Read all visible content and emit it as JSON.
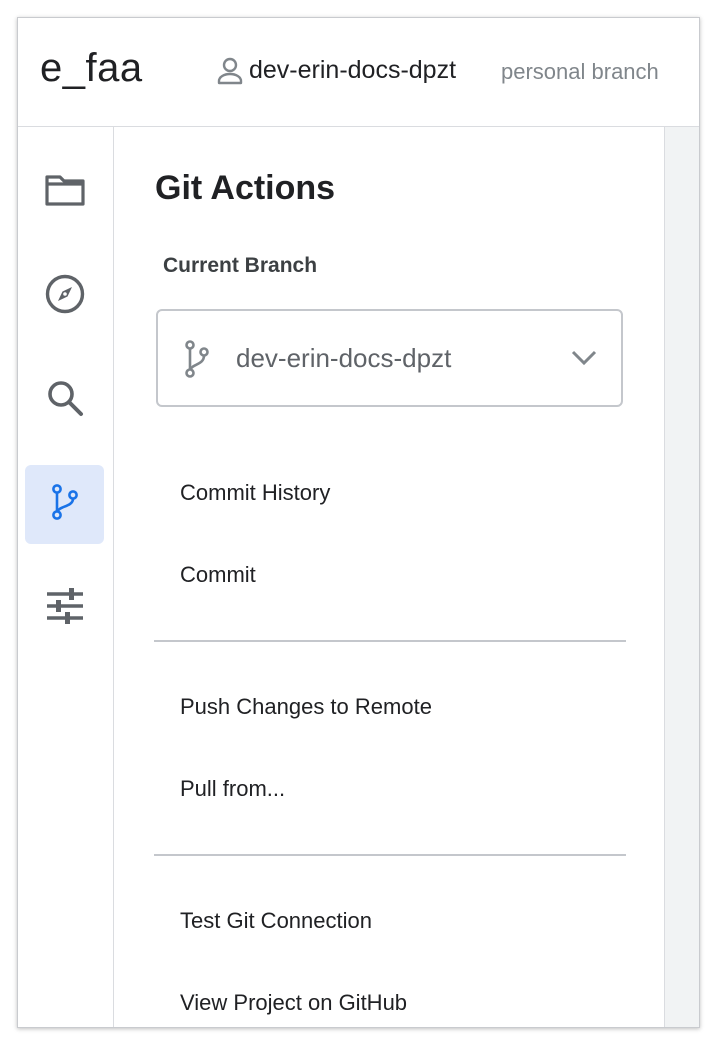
{
  "header": {
    "project_name": "e_faa",
    "user_icon": "person-outline-icon",
    "user_name": "dev-erin-docs-dpzt",
    "branch_type": "personal branch"
  },
  "sidebar": {
    "items": [
      {
        "name": "file-browser",
        "icon": "folder-icon",
        "active": false
      },
      {
        "name": "object-browser",
        "icon": "compass-icon",
        "active": false
      },
      {
        "name": "search",
        "icon": "search-icon",
        "active": false
      },
      {
        "name": "git-actions",
        "icon": "git-branch-icon",
        "active": true
      },
      {
        "name": "settings",
        "icon": "sliders-icon",
        "active": false
      }
    ]
  },
  "panel": {
    "title": "Git Actions",
    "current_branch_label": "Current Branch",
    "branch_select": {
      "icon": "git-branch-icon",
      "value": "dev-erin-docs-dpzt",
      "dropdown_icon": "chevron-down-icon"
    },
    "groups": [
      [
        "Commit History",
        "Commit"
      ],
      [
        "Push Changes to Remote",
        "Pull from..."
      ],
      [
        "Test Git Connection",
        "View Project on GitHub"
      ]
    ]
  },
  "colors": {
    "accent": "#1a73e8",
    "active_bg": "#dfe8fa",
    "icon_gray": "#5f6368",
    "text_dark": "#202124",
    "text_muted": "#80868b"
  }
}
